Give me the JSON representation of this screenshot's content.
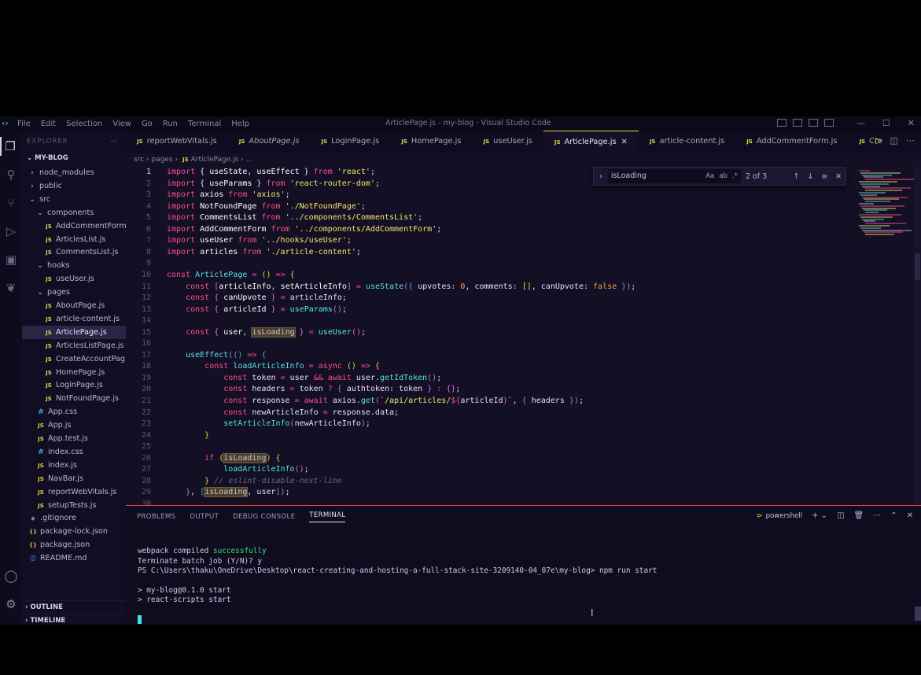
{
  "window": {
    "title": "ArticlePage.js - my-blog - Visual Studio Code",
    "menu": [
      "File",
      "Edit",
      "Selection",
      "View",
      "Go",
      "Run",
      "Terminal",
      "Help"
    ],
    "controls": [
      "—",
      "☐",
      "✕"
    ]
  },
  "sidebar": {
    "header": "EXPLORER",
    "root": "MY-BLOG",
    "items": [
      {
        "label": "node_modules",
        "type": "folder",
        "depth": 0
      },
      {
        "label": "public",
        "type": "folder",
        "depth": 0
      },
      {
        "label": "src",
        "type": "folder-open",
        "depth": 0
      },
      {
        "label": "components",
        "type": "folder-open",
        "depth": 1
      },
      {
        "label": "AddCommentForm...",
        "type": "js",
        "depth": 2
      },
      {
        "label": "ArticlesList.js",
        "type": "js",
        "depth": 2
      },
      {
        "label": "CommentsList.js",
        "type": "js",
        "depth": 2
      },
      {
        "label": "hooks",
        "type": "folder-open",
        "depth": 1
      },
      {
        "label": "useUser.js",
        "type": "js",
        "depth": 2
      },
      {
        "label": "pages",
        "type": "folder-open",
        "depth": 1
      },
      {
        "label": "AboutPage.js",
        "type": "js",
        "depth": 2
      },
      {
        "label": "article-content.js",
        "type": "js",
        "depth": 2
      },
      {
        "label": "ArticlePage.js",
        "type": "js",
        "depth": 2,
        "selected": true
      },
      {
        "label": "ArticlesListPage.js",
        "type": "js",
        "depth": 2
      },
      {
        "label": "CreateAccountPag...",
        "type": "js",
        "depth": 2
      },
      {
        "label": "HomePage.js",
        "type": "js",
        "depth": 2
      },
      {
        "label": "LoginPage.js",
        "type": "js",
        "depth": 2
      },
      {
        "label": "NotFoundPage.js",
        "type": "js",
        "depth": 2
      },
      {
        "label": "App.css",
        "type": "css",
        "depth": 1
      },
      {
        "label": "App.js",
        "type": "js",
        "depth": 1
      },
      {
        "label": "App.test.js",
        "type": "js",
        "depth": 1
      },
      {
        "label": "index.css",
        "type": "css",
        "depth": 1
      },
      {
        "label": "index.js",
        "type": "js",
        "depth": 1
      },
      {
        "label": "NavBar.js",
        "type": "js",
        "depth": 1
      },
      {
        "label": "reportWebVitals.js",
        "type": "js",
        "depth": 1
      },
      {
        "label": "setupTests.js",
        "type": "js",
        "depth": 1
      },
      {
        "label": ".gitignore",
        "type": "git",
        "depth": 0
      },
      {
        "label": "package-lock.json",
        "type": "json",
        "depth": 0
      },
      {
        "label": "package.json",
        "type": "json",
        "depth": 0
      },
      {
        "label": "README.md",
        "type": "md",
        "depth": 0
      }
    ],
    "outline": "OUTLINE",
    "timeline": "TIMELINE"
  },
  "tabs": [
    {
      "label": "reportWebVitals.js"
    },
    {
      "label": "AboutPage.js",
      "italic": true
    },
    {
      "label": "LoginPage.js"
    },
    {
      "label": "HomePage.js"
    },
    {
      "label": "useUser.js"
    },
    {
      "label": "ArticlePage.js",
      "active": true
    },
    {
      "label": "article-content.js"
    },
    {
      "label": "AddCommentForm.js"
    },
    {
      "label": "Cre"
    }
  ],
  "breadcrumb": {
    "parts": [
      "src",
      "pages"
    ],
    "file": "ArticlePage.js",
    "tail": "..."
  },
  "find": {
    "value": "isLoading",
    "count": "2 of 3",
    "opts": [
      "Aa",
      "ab",
      ".*"
    ]
  },
  "code": [
    [
      [
        "k",
        "import"
      ],
      [
        "p",
        " { "
      ],
      [
        "v",
        "useState"
      ],
      [
        "p",
        ", "
      ],
      [
        "v",
        "useEffect"
      ],
      [
        "p",
        " } "
      ],
      [
        "k",
        "from"
      ],
      [
        "p",
        " "
      ],
      [
        "s",
        "'react'"
      ],
      [
        "p",
        ";"
      ]
    ],
    [
      [
        "k",
        "import"
      ],
      [
        "p",
        " { "
      ],
      [
        "v",
        "useParams"
      ],
      [
        "p",
        " } "
      ],
      [
        "k",
        "from"
      ],
      [
        "p",
        " "
      ],
      [
        "s",
        "'react-router-dom'"
      ],
      [
        "p",
        ";"
      ]
    ],
    [
      [
        "k",
        "import"
      ],
      [
        "p",
        " "
      ],
      [
        "v",
        "axios"
      ],
      [
        "p",
        " "
      ],
      [
        "k",
        "from"
      ],
      [
        "p",
        " "
      ],
      [
        "s",
        "'axios'"
      ],
      [
        "p",
        ";"
      ]
    ],
    [
      [
        "k",
        "import"
      ],
      [
        "p",
        " "
      ],
      [
        "v",
        "NotFoundPage"
      ],
      [
        "p",
        " "
      ],
      [
        "k",
        "from"
      ],
      [
        "p",
        " "
      ],
      [
        "s",
        "'./NotFoundPage'"
      ],
      [
        "p",
        ";"
      ]
    ],
    [
      [
        "k",
        "import"
      ],
      [
        "p",
        " "
      ],
      [
        "v",
        "CommentsList"
      ],
      [
        "p",
        " "
      ],
      [
        "k",
        "from"
      ],
      [
        "p",
        " "
      ],
      [
        "s",
        "'../components/CommentsList'"
      ],
      [
        "p",
        ";"
      ]
    ],
    [
      [
        "k",
        "import"
      ],
      [
        "p",
        " "
      ],
      [
        "v",
        "AddCommentForm"
      ],
      [
        "p",
        " "
      ],
      [
        "k",
        "from"
      ],
      [
        "p",
        " "
      ],
      [
        "s",
        "'../components/AddCommentForm'"
      ],
      [
        "p",
        ";"
      ]
    ],
    [
      [
        "k",
        "import"
      ],
      [
        "p",
        " "
      ],
      [
        "v",
        "useUser"
      ],
      [
        "p",
        " "
      ],
      [
        "k",
        "from"
      ],
      [
        "p",
        " "
      ],
      [
        "s",
        "'../hooks/useUser'"
      ],
      [
        "p",
        ";"
      ]
    ],
    [
      [
        "k",
        "import"
      ],
      [
        "p",
        " "
      ],
      [
        "v",
        "articles"
      ],
      [
        "p",
        " "
      ],
      [
        "k",
        "from"
      ],
      [
        "p",
        " "
      ],
      [
        "s",
        "'./article-content'"
      ],
      [
        "p",
        ";"
      ]
    ],
    [],
    [
      [
        "k",
        "const"
      ],
      [
        "p",
        " "
      ],
      [
        "f",
        "ArticlePage"
      ],
      [
        "p",
        " "
      ],
      [
        "k",
        "="
      ],
      [
        "p",
        " "
      ],
      [
        "b1",
        "("
      ],
      [
        "b1",
        ")"
      ],
      [
        "p",
        " "
      ],
      [
        "k",
        "=>"
      ],
      [
        "p",
        " "
      ],
      [
        "b1",
        "{"
      ]
    ],
    [
      [
        "p",
        "    "
      ],
      [
        "k",
        "const"
      ],
      [
        "p",
        " "
      ],
      [
        "b2",
        "["
      ],
      [
        "v",
        "articleInfo"
      ],
      [
        "p",
        ", "
      ],
      [
        "v",
        "setArticleInfo"
      ],
      [
        "b2",
        "]"
      ],
      [
        "p",
        " "
      ],
      [
        "k",
        "="
      ],
      [
        "p",
        " "
      ],
      [
        "f",
        "useState"
      ],
      [
        "b2",
        "("
      ],
      [
        "b3",
        "{"
      ],
      [
        "p",
        " upvotes: "
      ],
      [
        "n",
        "0"
      ],
      [
        "p",
        ", comments: "
      ],
      [
        "b1",
        "[]"
      ],
      [
        "p",
        ", canUpvote: "
      ],
      [
        "n",
        "false"
      ],
      [
        "p",
        " "
      ],
      [
        "b3",
        "}"
      ],
      [
        "b2",
        ")"
      ],
      [
        "p",
        ";"
      ]
    ],
    [
      [
        "p",
        "    "
      ],
      [
        "k",
        "const"
      ],
      [
        "p",
        " "
      ],
      [
        "b2",
        "{"
      ],
      [
        "p",
        " "
      ],
      [
        "v",
        "canUpvote"
      ],
      [
        "p",
        " "
      ],
      [
        "b2",
        "}"
      ],
      [
        "p",
        " "
      ],
      [
        "k",
        "="
      ],
      [
        "p",
        " articleInfo;"
      ]
    ],
    [
      [
        "p",
        "    "
      ],
      [
        "k",
        "const"
      ],
      [
        "p",
        " "
      ],
      [
        "b2",
        "{"
      ],
      [
        "p",
        " "
      ],
      [
        "v",
        "articleId"
      ],
      [
        "p",
        " "
      ],
      [
        "b2",
        "}"
      ],
      [
        "p",
        " "
      ],
      [
        "k",
        "="
      ],
      [
        "p",
        " "
      ],
      [
        "f",
        "useParams"
      ],
      [
        "b2",
        "()"
      ],
      [
        "p",
        ";"
      ]
    ],
    [],
    [
      [
        "p",
        "    "
      ],
      [
        "k",
        "const"
      ],
      [
        "p",
        " "
      ],
      [
        "b2",
        "{"
      ],
      [
        "p",
        " "
      ],
      [
        "v",
        "user"
      ],
      [
        "p",
        ", "
      ],
      [
        "hl",
        "isLoading"
      ],
      [
        "p",
        " "
      ],
      [
        "b2",
        "}"
      ],
      [
        "p",
        " "
      ],
      [
        "k",
        "="
      ],
      [
        "p",
        " "
      ],
      [
        "f",
        "useUser"
      ],
      [
        "b2",
        "()"
      ],
      [
        "p",
        ";"
      ]
    ],
    [],
    [
      [
        "p",
        "    "
      ],
      [
        "f",
        "useEffect"
      ],
      [
        "b2",
        "("
      ],
      [
        "b3",
        "()"
      ],
      [
        "p",
        " "
      ],
      [
        "k",
        "=>"
      ],
      [
        "p",
        " "
      ],
      [
        "b3",
        "{"
      ]
    ],
    [
      [
        "p",
        "        "
      ],
      [
        "k",
        "const"
      ],
      [
        "p",
        " "
      ],
      [
        "f",
        "loadArticleInfo"
      ],
      [
        "p",
        " "
      ],
      [
        "k",
        "="
      ],
      [
        "p",
        " "
      ],
      [
        "k",
        "async"
      ],
      [
        "p",
        " "
      ],
      [
        "b1",
        "()"
      ],
      [
        "p",
        " "
      ],
      [
        "k",
        "=>"
      ],
      [
        "p",
        " "
      ],
      [
        "b1",
        "{"
      ]
    ],
    [
      [
        "p",
        "            "
      ],
      [
        "k",
        "const"
      ],
      [
        "p",
        " token "
      ],
      [
        "k",
        "="
      ],
      [
        "p",
        " user "
      ],
      [
        "k",
        "&&"
      ],
      [
        "p",
        " "
      ],
      [
        "k",
        "await"
      ],
      [
        "p",
        " user."
      ],
      [
        "f",
        "getIdToken"
      ],
      [
        "b2",
        "()"
      ],
      [
        "p",
        ";"
      ]
    ],
    [
      [
        "p",
        "            "
      ],
      [
        "k",
        "const"
      ],
      [
        "p",
        " headers "
      ],
      [
        "k",
        "="
      ],
      [
        "p",
        " token "
      ],
      [
        "k",
        "?"
      ],
      [
        "p",
        " "
      ],
      [
        "b2",
        "{"
      ],
      [
        "p",
        " authtoken: token "
      ],
      [
        "b2",
        "}"
      ],
      [
        "p",
        " "
      ],
      [
        "k",
        ":"
      ],
      [
        "p",
        " "
      ],
      [
        "b2",
        "{}"
      ],
      [
        "p",
        ";"
      ]
    ],
    [
      [
        "p",
        "            "
      ],
      [
        "k",
        "const"
      ],
      [
        "p",
        " response "
      ],
      [
        "k",
        "="
      ],
      [
        "p",
        " "
      ],
      [
        "k",
        "await"
      ],
      [
        "p",
        " axios."
      ],
      [
        "f",
        "get"
      ],
      [
        "b2",
        "("
      ],
      [
        "s",
        "`/api/articles/"
      ],
      [
        "k",
        "${"
      ],
      [
        "p",
        "articleId"
      ],
      [
        "k",
        "}"
      ],
      [
        "s",
        "`"
      ],
      [
        "p",
        ", "
      ],
      [
        "b3",
        "{"
      ],
      [
        "p",
        " headers "
      ],
      [
        "b3",
        "}"
      ],
      [
        "b2",
        ")"
      ],
      [
        "p",
        ";"
      ]
    ],
    [
      [
        "p",
        "            "
      ],
      [
        "k",
        "const"
      ],
      [
        "p",
        " newArticleInfo "
      ],
      [
        "k",
        "="
      ],
      [
        "p",
        " response.data;"
      ]
    ],
    [
      [
        "p",
        "            "
      ],
      [
        "f",
        "setArticleInfo"
      ],
      [
        "b2",
        "("
      ],
      [
        "p",
        "newArticleInfo"
      ],
      [
        "b2",
        ")"
      ],
      [
        "p",
        ";"
      ]
    ],
    [
      [
        "p",
        "        "
      ],
      [
        "b1",
        "}"
      ]
    ],
    [],
    [
      [
        "p",
        "        "
      ],
      [
        "k",
        "if"
      ],
      [
        "p",
        " "
      ],
      [
        "b1",
        "("
      ],
      [
        "hl",
        "isLoading"
      ],
      [
        "b1",
        ")"
      ],
      [
        "p",
        " "
      ],
      [
        "b1",
        "{"
      ]
    ],
    [
      [
        "p",
        "            "
      ],
      [
        "f",
        "loadArticleInfo"
      ],
      [
        "b2",
        "()"
      ],
      [
        "p",
        ";"
      ]
    ],
    [
      [
        "p",
        "        "
      ],
      [
        "b1",
        "}"
      ],
      [
        "p",
        " "
      ],
      [
        "c",
        "// eslint-disable-next-line"
      ]
    ],
    [
      [
        "p",
        "    "
      ],
      [
        "b3",
        "}"
      ],
      [
        "p",
        ", "
      ],
      [
        "b3",
        "["
      ],
      [
        "hl",
        "isLoading"
      ],
      [
        "p",
        ", user"
      ],
      [
        "b3",
        "]"
      ],
      [
        "b2",
        ")"
      ],
      [
        "p",
        ";"
      ]
    ],
    [
      [
        "p",
        ""
      ]
    ]
  ],
  "panel": {
    "tabs": [
      "PROBLEMS",
      "OUTPUT",
      "DEBUG CONSOLE",
      "TERMINAL"
    ],
    "active": "TERMINAL",
    "shell": "powershell",
    "terminal": [
      "",
      "webpack compiled |successfully",
      "Terminate batch job (Y/N)? y",
      "PS C:\\Users\\thaku\\OneDrive\\Desktop\\react-creating-and-hosting-a-full-stack-site-3209140-04_07e\\my-blog> npm run start",
      "",
      "> my-blog@0.1.0 start",
      "> react-scripts start",
      ""
    ]
  }
}
